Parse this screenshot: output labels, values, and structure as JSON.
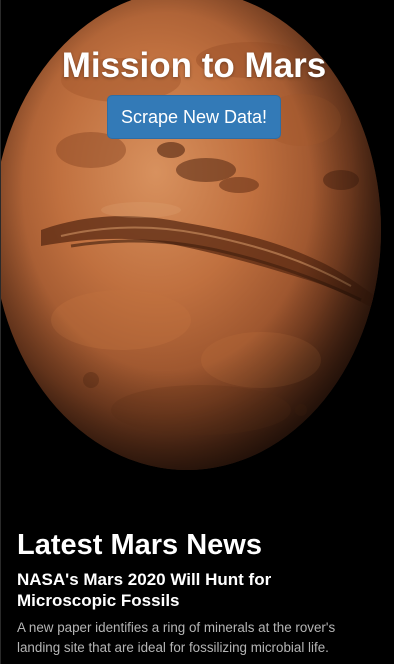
{
  "jumbotron": {
    "title": "Mission to Mars",
    "button_label": "Scrape New Data!"
  },
  "news": {
    "section_heading": "Latest Mars News",
    "article_title": "NASA's Mars 2020 Will Hunt for Microscopic Fossils",
    "article_teaser": "A new paper identifies a ring of minerals at the rover's landing site that are ideal for fossilizing microbial life."
  },
  "colors": {
    "background": "#000000",
    "button": "#337ab7",
    "mars_surface": "#b8683c",
    "teaser_text": "#b5b5b5"
  },
  "images": {
    "hero_icon": "mars-globe-icon"
  }
}
